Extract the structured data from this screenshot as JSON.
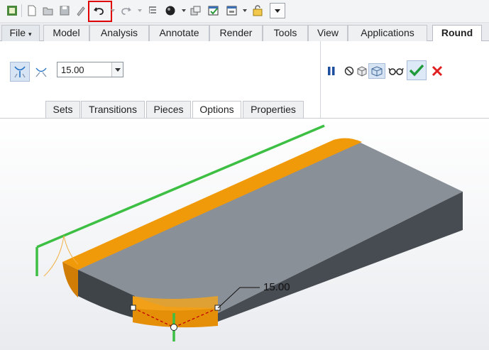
{
  "quick_access": {
    "icons": [
      "app-icon",
      "new-icon",
      "open-icon",
      "save-icon",
      "regenerate-icon",
      "undo-icon",
      "redo-icon",
      "model-tree-icon",
      "appearance-icon",
      "windows-icon",
      "switch-window-icon",
      "close-window-icon",
      "more-icon"
    ]
  },
  "tabs": [
    {
      "label": "File"
    },
    {
      "label": "Model"
    },
    {
      "label": "Analysis"
    },
    {
      "label": "Annotate"
    },
    {
      "label": "Render"
    },
    {
      "label": "Tools"
    },
    {
      "label": "View"
    },
    {
      "label": "Applications"
    },
    {
      "label": "Round"
    }
  ],
  "active_tab": "Round",
  "round": {
    "radius_value": "15.00",
    "subtabs": [
      {
        "label": "Sets"
      },
      {
        "label": "Transitions"
      },
      {
        "label": "Pieces"
      },
      {
        "label": "Options"
      },
      {
        "label": "Properties"
      }
    ],
    "active_subtab": "Options"
  },
  "viewport": {
    "dimension_label": "15.00"
  },
  "colors": {
    "round_surface": "#f09a0a",
    "model_gray": "#8a9097",
    "edge_green": "#3cbf42",
    "confirm_green": "#1e9a3a",
    "cancel_red": "#e02020",
    "highlight_red": "#e10000"
  }
}
